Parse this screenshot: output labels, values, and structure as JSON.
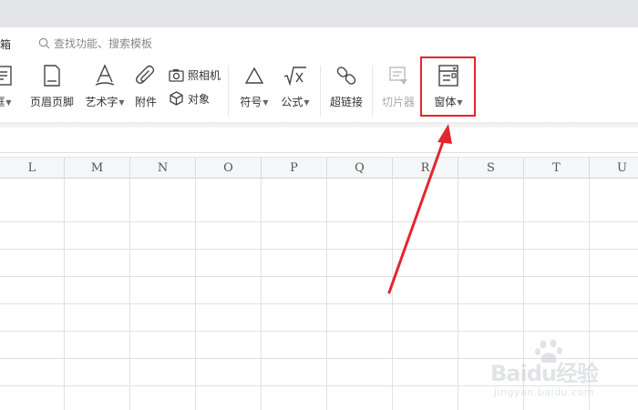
{
  "menu": {
    "partial_item": "具箱"
  },
  "search": {
    "placeholder": "查找功能、搜索模板"
  },
  "ribbon": {
    "textbox_label": "框",
    "header_footer_label": "页眉页脚",
    "wordart_label": "艺术字",
    "attachment_label": "附件",
    "camera_label": "照相机",
    "object_label": "对象",
    "symbol_label": "符号",
    "formula_label": "公式",
    "hyperlink_label": "超链接",
    "slicer_label": "切片器",
    "form_label": "窗体"
  },
  "columns": [
    "L",
    "M",
    "N",
    "O",
    "P",
    "Q",
    "R",
    "S",
    "T",
    "U"
  ],
  "highlight_color": "#e3262f",
  "watermark": {
    "brand": "Baidu经验",
    "url": "jingyan.baidu.com"
  }
}
